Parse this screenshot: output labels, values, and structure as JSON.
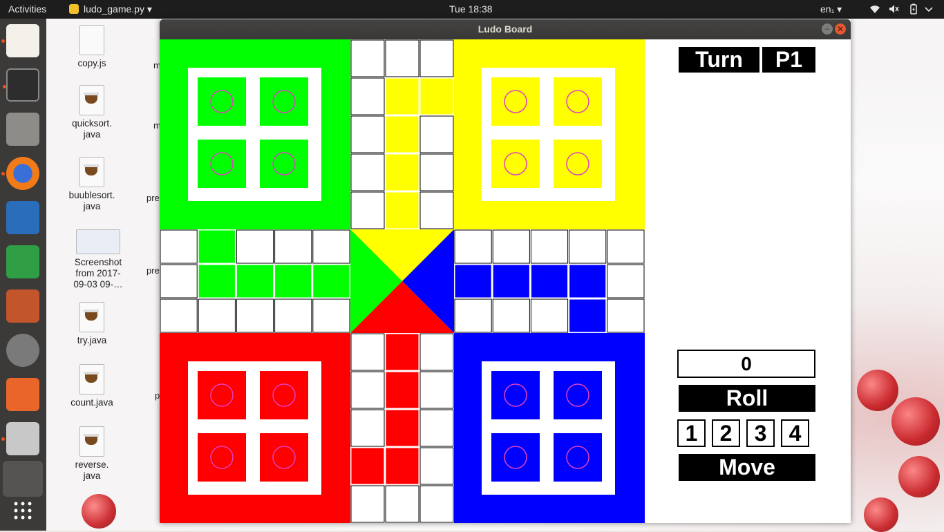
{
  "top_bar": {
    "activities": "Activities",
    "app_menu": "ludo_game.py ▾",
    "clock": "Tue 18:38",
    "language": "en₁ ▾"
  },
  "desktop": {
    "icons": [
      {
        "label": "copy.js"
      },
      {
        "label": "quicksort.\njava"
      },
      {
        "label": "buublesort.\njava"
      },
      {
        "label": "Screenshot\nfrom 2017-\n09-03 09-…"
      },
      {
        "label": "try.java"
      },
      {
        "label": "count.java"
      },
      {
        "label": "reverse.\njava"
      }
    ],
    "partial_labels": [
      "m",
      "m",
      "pre",
      "pre",
      "p"
    ]
  },
  "window": {
    "title": "Ludo Board",
    "colors": {
      "green": "#00ff00",
      "yellow": "#ffff00",
      "red": "#ff0000",
      "blue": "#0000ff",
      "token_ring": "#e040c0"
    },
    "panel": {
      "turn_label": "Turn",
      "turn_player": "P1",
      "dice_value": "0",
      "roll_label": "Roll",
      "pawn_buttons": [
        "1",
        "2",
        "3",
        "4"
      ],
      "move_label": "Move"
    }
  },
  "icons": {
    "launcher": [
      "text-editor-icon",
      "terminal-icon",
      "files-icon",
      "firefox-icon",
      "writer-icon",
      "calc-icon",
      "impress-icon",
      "settings-icon",
      "software-icon",
      "scanner-icon",
      "game-icon",
      "app-grid-icon"
    ],
    "tray": [
      "wifi-icon",
      "volume-icon",
      "battery-icon",
      "power-icon"
    ]
  }
}
